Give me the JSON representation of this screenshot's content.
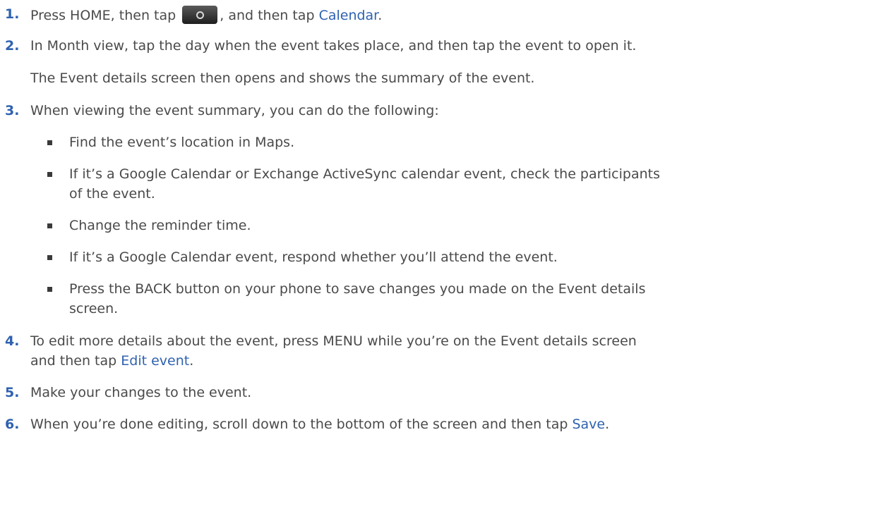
{
  "steps": [
    {
      "num": "1.",
      "pre": "Press HOME, then tap ",
      "icon": "all-apps-icon",
      "mid": ", and then tap ",
      "link": "Calendar",
      "post": "."
    },
    {
      "num": "2.",
      "text": "In Month view, tap the day when the event takes place, and then tap the event to open it.",
      "note": "The Event details screen then opens and shows the summary of the event."
    },
    {
      "num": "3.",
      "text": "When viewing the event summary, you can do the following:",
      "bullets": [
        {
          "lines": [
            "Find the event’s location in Maps."
          ]
        },
        {
          "lines": [
            "If it’s a Google Calendar or Exchange ActiveSync calendar event, check the participants",
            "of the event."
          ]
        },
        {
          "lines": [
            "Change the reminder time."
          ]
        },
        {
          "lines": [
            "If it’s a Google Calendar event, respond whether you’ll attend the event."
          ]
        },
        {
          "lines": [
            "Press the BACK button on your phone to save changes you made on the Event details",
            "screen."
          ]
        }
      ]
    },
    {
      "num": "4.",
      "line1": "To edit more details about the event, press MENU while you’re on the Event details screen",
      "line2_pre": "and then tap ",
      "link": "Edit event",
      "post": "."
    },
    {
      "num": "5.",
      "text": "Make your changes to the event."
    },
    {
      "num": "6.",
      "pre": "When you’re done editing, scroll down to the bottom of the screen and then tap ",
      "link": "Save",
      "post": "."
    }
  ]
}
